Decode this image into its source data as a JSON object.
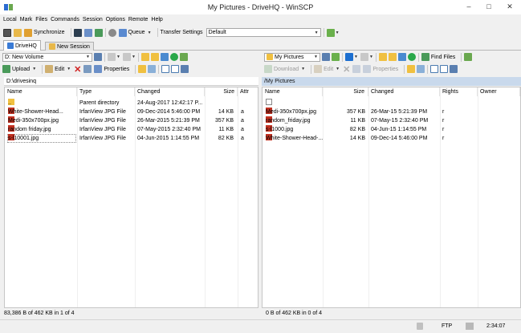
{
  "window": {
    "title": "My Pictures - DriveHQ - WinSCP"
  },
  "menu": [
    "Local",
    "Mark",
    "Files",
    "Commands",
    "Session",
    "Options",
    "Remote",
    "Help"
  ],
  "toolbar": {
    "synchronize": "Synchronize",
    "queue": "Queue",
    "transfer_settings_label": "Transfer Settings",
    "transfer_settings_value": "Default"
  },
  "tabs": [
    {
      "label": "DriveHQ"
    },
    {
      "label": "New Session"
    }
  ],
  "left": {
    "drive": "D: New Volume",
    "actions": {
      "upload": "Upload",
      "edit": "Edit",
      "properties": "Properties"
    },
    "path": "D:\\drivesinq",
    "columns": [
      "Name",
      "Type",
      "Changed",
      "Size",
      "Attr"
    ],
    "rows": [
      {
        "name": "..",
        "type": "Parent directory",
        "changed": "24-Aug-2017  12:42:17 P...",
        "size": "",
        "attr": ""
      },
      {
        "name": "White-Shower-Head...",
        "type": "IrfanView JPG File",
        "changed": "09-Dec-2014  5:46:00 PM",
        "size": "14 KB",
        "attr": "a"
      },
      {
        "name": "Medi-350x700px.jpg",
        "type": "IrfanView JPG File",
        "changed": "26-Mar-2015  5:21:39 PM",
        "size": "357 KB",
        "attr": "a"
      },
      {
        "name": "random friday.jpg",
        "type": "IrfanView JPG File",
        "changed": "07-May-2015  2:32:40 PM",
        "size": "11 KB",
        "attr": "a"
      },
      {
        "name": "s-l10001.jpg",
        "type": "IrfanView JPG File",
        "changed": "04-Jun-2015  1:14:55 PM",
        "size": "82 KB",
        "attr": "a"
      }
    ],
    "status": "83,386 B of 462 KB in 1 of 4"
  },
  "right": {
    "folder": "My Pictures",
    "find_files": "Find Files",
    "actions": {
      "download": "Download",
      "edit": "Edit",
      "properties": "Properties"
    },
    "path": "/My Pictures",
    "columns": [
      "Name",
      "Size",
      "Changed",
      "Rights",
      "Owner"
    ],
    "rows": [
      {
        "name": "..",
        "size": "",
        "changed": "",
        "rights": ""
      },
      {
        "name": "Medi-350x700px.jpg",
        "size": "357 KB",
        "changed": "26-Mar-15  5:21:39 PM",
        "rights": "r"
      },
      {
        "name": "random_friday.jpg",
        "size": "11 KB",
        "changed": "07-May-15  2:32:40 PM",
        "rights": "r"
      },
      {
        "name": "s-l1000.jpg",
        "size": "82 KB",
        "changed": "04-Jun-15  1:14:55 PM",
        "rights": "r"
      },
      {
        "name": "White-Shower-Head-...",
        "size": "14 KB",
        "changed": "09-Dec-14  5:46:00 PM",
        "rights": "r"
      }
    ],
    "status": "0 B of 462 KB in 0 of 4"
  },
  "bottom": {
    "protocol": "FTP",
    "time": "2:34:07"
  },
  "colors": {
    "selected_path": "#c9d9ec",
    "folder": "#f0c040",
    "jpg": "#c03020",
    "refresh": "#2aa84a",
    "nav": "#1d6fd0"
  }
}
